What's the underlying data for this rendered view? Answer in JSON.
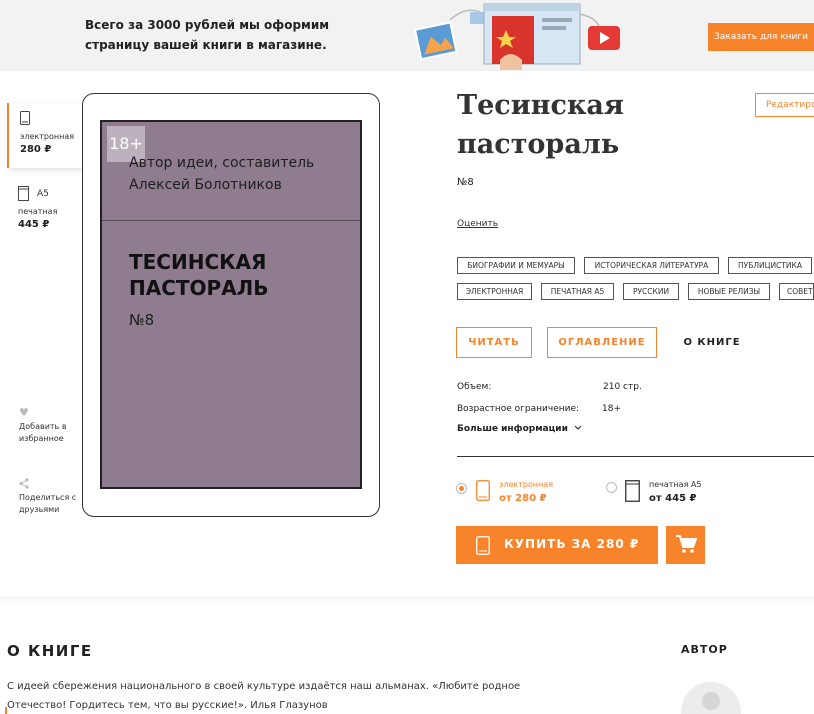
{
  "banner": {
    "text": "Всего за 3000 рублей мы оформим страницу вашей книги в магазине.",
    "button": "Заказать для книги"
  },
  "formats": {
    "electronic": {
      "label": "электронная",
      "price": "280 ₽"
    },
    "print": {
      "size": "A5",
      "label": "печатная",
      "price": "445 ₽"
    }
  },
  "side": {
    "favorite": "Добавить в избранное",
    "share": "Поделиться с друзьями"
  },
  "cover": {
    "age": "18+",
    "author": "Автор идеи, составитель Алексей Болотников",
    "title": "ТЕСИНСКАЯ ПАСТОРАЛЬ",
    "number": "№8"
  },
  "book": {
    "title": "Тесинская пастораль",
    "number": "№8",
    "edit_button": "Редактировать",
    "rate": "Оценить"
  },
  "tags": [
    "БИОГРАФИИ И МЕМУАРЫ",
    "ИСТОРИЧЕСКАЯ ЛИТЕРАТУРА",
    "ПУБЛИЦИСТИКА",
    "ЭЛЕКТРОННАЯ",
    "ПЕЧАТНАЯ А5",
    "РУССКИИ",
    "НОВЫЕ РЕЛИЗЫ",
    "СОВЕТСКАЯ"
  ],
  "tabs": {
    "read": "ЧИТАТЬ",
    "toc": "ОГЛАВЛЕНИЕ",
    "about": "О КНИГЕ"
  },
  "meta": {
    "volume_label": "Объем:",
    "volume_value": "210 стр.",
    "age_label": "Возрастное ограничение:",
    "age_value": "18+",
    "more": "Больше информации"
  },
  "options": {
    "electronic": {
      "label": "электронная",
      "price": "от 280 ₽",
      "selected": true
    },
    "print": {
      "label": "печатная A5",
      "price": "от 445 ₽",
      "selected": false
    }
  },
  "buy": {
    "label": "КУПИТЬ ЗА 280 ₽"
  },
  "about": {
    "heading": "О КНИГЕ",
    "text": "С идеей сбережения национального в своей культуре издаётся наш альманах. «Любите родное Отечество! Гордитесь тем, что вы русские!». Илья Глазунов"
  },
  "author": {
    "heading": "АВТОР"
  },
  "colors": {
    "accent": "#f7842a",
    "cover": "#8f7d8f"
  }
}
